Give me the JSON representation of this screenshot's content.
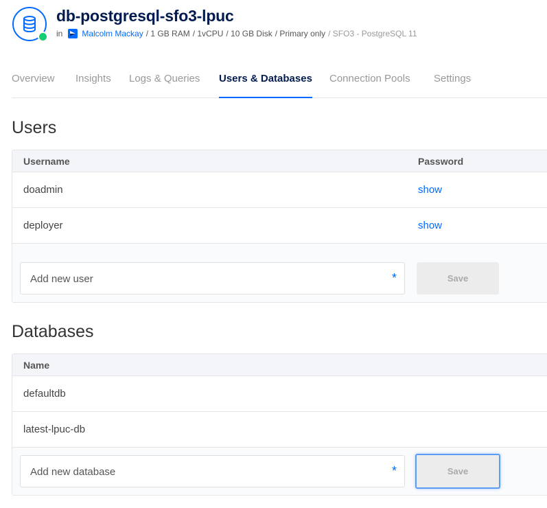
{
  "header": {
    "title": "db-postgresql-sfo3-lpuc",
    "in_label": "in",
    "team_name": "Malcolm Mackay",
    "specs": [
      {
        "text": "/ 1 GB RAM",
        "muted": false
      },
      {
        "text": "/ 1vCPU",
        "muted": false
      },
      {
        "text": "/ 10 GB Disk",
        "muted": false
      },
      {
        "text": "/ Primary only",
        "muted": false
      },
      {
        "text": "/ SFO3 - PostgreSQL 11",
        "muted": true
      }
    ],
    "status_color": "#15cd72"
  },
  "tabs": [
    {
      "label": "Overview"
    },
    {
      "label": "Insights"
    },
    {
      "label": "Logs & Queries"
    },
    {
      "label": "Users & Databases",
      "active": true
    },
    {
      "label": "Connection Pools"
    },
    {
      "label": "Settings"
    }
  ],
  "users": {
    "title": "Users",
    "col_username": "Username",
    "col_password": "Password",
    "rows": [
      {
        "username": "doadmin",
        "password_action": "show"
      },
      {
        "username": "deployer",
        "password_action": "show"
      }
    ],
    "add_placeholder": "Add new user",
    "required_mark": "*",
    "save_label": "Save"
  },
  "databases": {
    "title": "Databases",
    "col_name": "Name",
    "rows": [
      {
        "name": "defaultdb"
      },
      {
        "name": "latest-lpuc-db"
      }
    ],
    "add_placeholder": "Add new database",
    "required_mark": "*",
    "save_label": "Save"
  },
  "colors": {
    "accent": "#0069ff",
    "title": "#031b4e",
    "online": "#15cd72"
  }
}
